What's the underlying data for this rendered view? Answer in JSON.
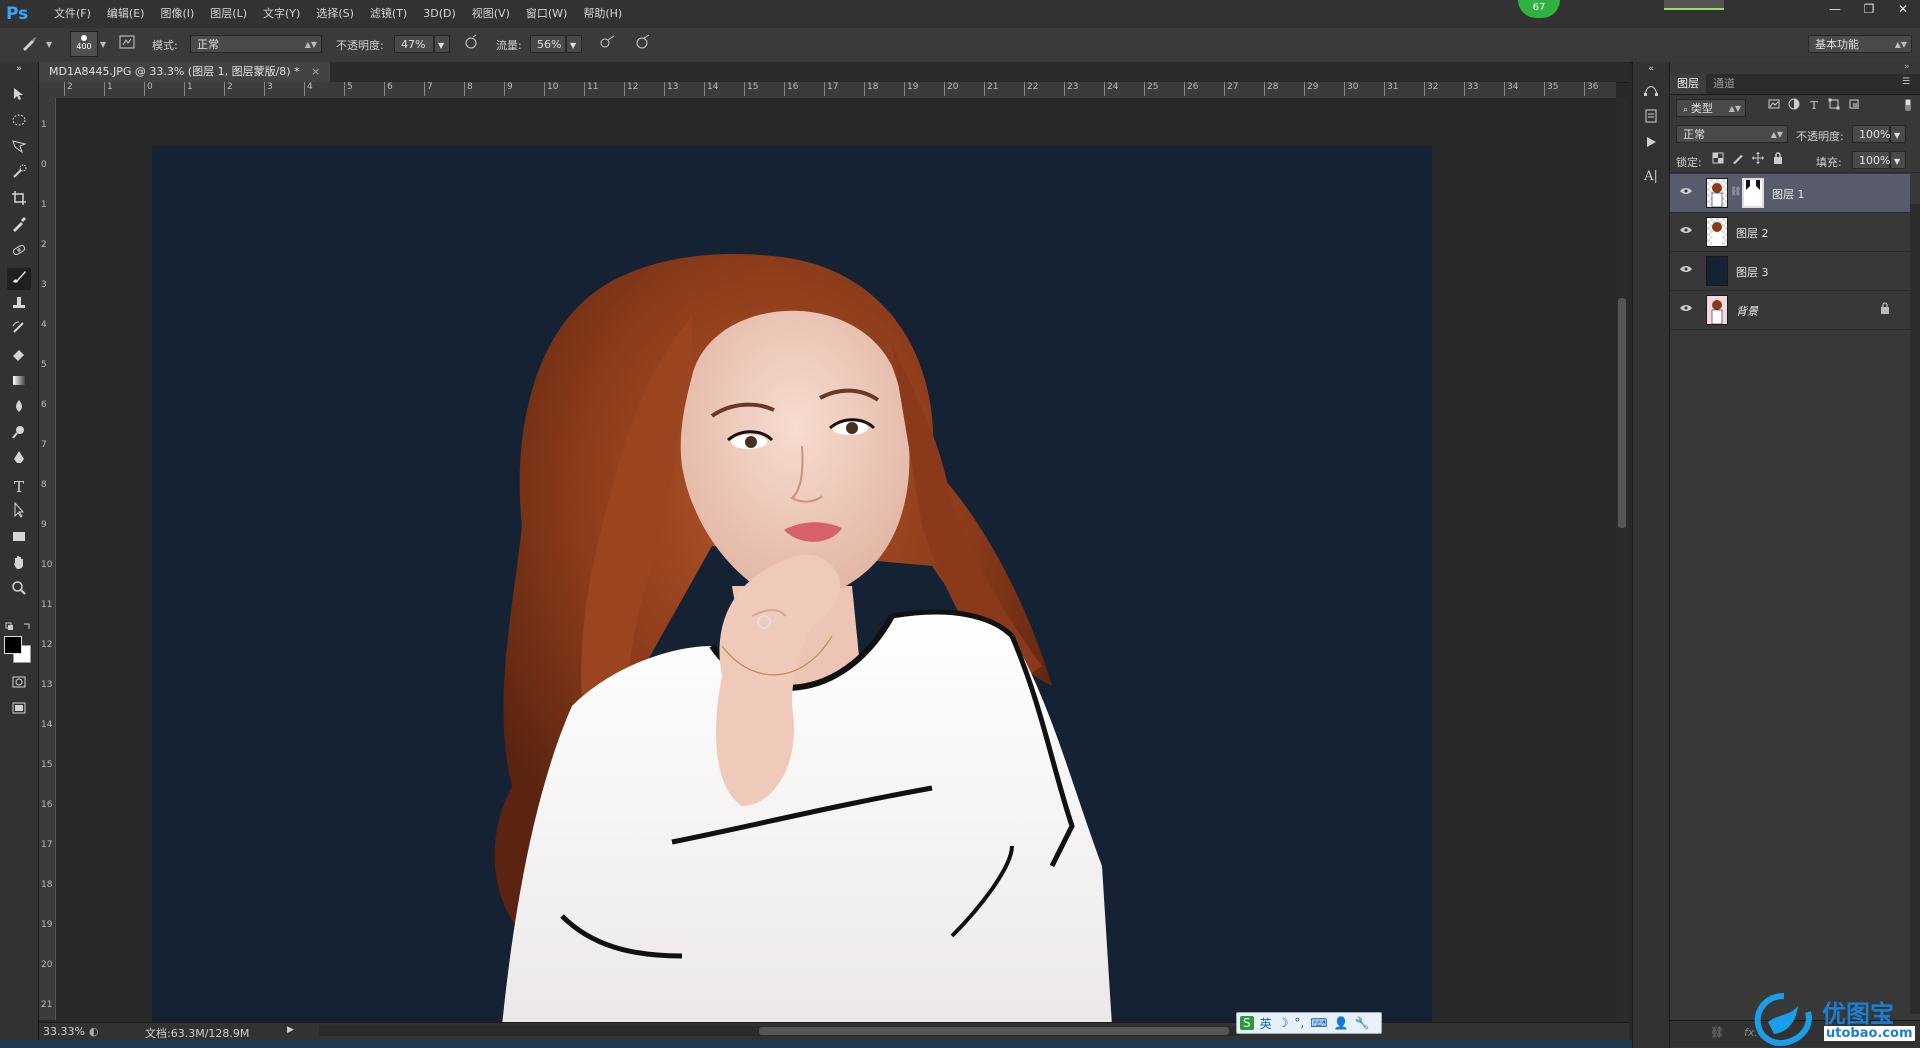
{
  "app": {
    "logo": "Ps",
    "menu": [
      "文件(F)",
      "编辑(E)",
      "图像(I)",
      "图层(L)",
      "文字(Y)",
      "选择(S)",
      "滤镜(T)",
      "3D(D)",
      "视图(V)",
      "窗口(W)",
      "帮助(H)"
    ],
    "badge": "67",
    "window_controls": [
      "—",
      "❐",
      "✕"
    ]
  },
  "options": {
    "brush_size": "400",
    "mode_label": "模式:",
    "mode_value": "正常",
    "opacity_label": "不透明度:",
    "opacity_value": "47%",
    "flow_label": "流量:",
    "flow_value": "56%",
    "workspace": "基本功能"
  },
  "document": {
    "tab_title": "MD1A8445.JPG @ 33.3% (图层 1, 图层蒙版/8) *",
    "tab_close": "×",
    "ruler_top": [
      "2",
      "1",
      "0",
      "1",
      "2",
      "3",
      "4",
      "5",
      "6",
      "7",
      "8",
      "9",
      "10",
      "11",
      "12",
      "13",
      "14",
      "15",
      "16",
      "17",
      "18",
      "19",
      "20",
      "21",
      "22",
      "23",
      "24",
      "25",
      "26",
      "27",
      "28",
      "29",
      "30",
      "31",
      "32",
      "33",
      "34",
      "35",
      "36"
    ],
    "ruler_left": [
      "1",
      "0",
      "1",
      "2",
      "3",
      "4",
      "5",
      "6",
      "7",
      "8",
      "9",
      "10",
      "11",
      "12",
      "13",
      "14",
      "15",
      "16",
      "17",
      "18",
      "19",
      "20",
      "21"
    ]
  },
  "status": {
    "zoom": "33.33%",
    "doc_size": "文档:63.3M/128.9M"
  },
  "ime": {
    "items": [
      "S",
      "英",
      "☽",
      "°,",
      "⌨",
      "👤",
      "🔧"
    ]
  },
  "layers_panel": {
    "tabs": [
      "图层",
      "通道"
    ],
    "filter_kind": "类型",
    "blend_mode": "正常",
    "opacity_label": "不透明度:",
    "opacity_value": "100%",
    "lock_label": "锁定:",
    "fill_label": "填充:",
    "fill_value": "100%",
    "layers": [
      {
        "name": "图层 1",
        "selected": true,
        "has_mask": true
      },
      {
        "name": "图层 2",
        "selected": false,
        "has_mask": false
      },
      {
        "name": "图层 3",
        "selected": false,
        "has_mask": false
      },
      {
        "name": "背景",
        "selected": false,
        "has_mask": false,
        "locked": true
      }
    ],
    "footer": [
      "⛓",
      "fx."
    ]
  },
  "watermark": {
    "brand": "优图宝",
    "url": "utobao.com"
  },
  "colors": {
    "canvas_bg": "#142233",
    "accent_badge": "#30b240",
    "layer_selected": "#575b6c",
    "ps_blue": "#34a6ff"
  }
}
